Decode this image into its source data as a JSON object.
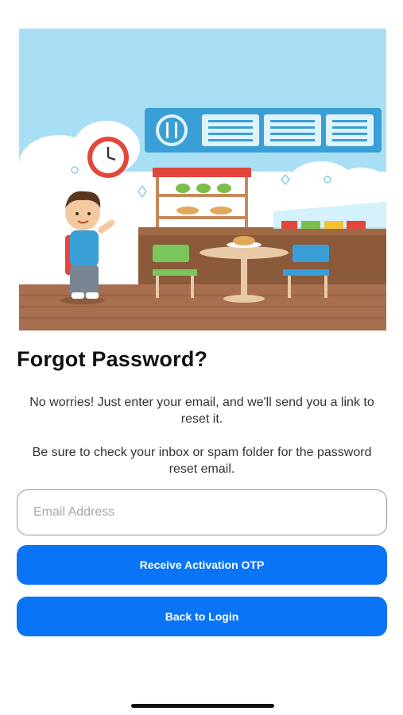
{
  "header": {
    "title": "Forgot Password?"
  },
  "main": {
    "description_1": "No worries! Just enter your email, and we'll send you a link to reset it.",
    "description_2": "Be sure to check your inbox or spam folder for the password reset email.",
    "email_input": {
      "placeholder": "Email Address",
      "value": ""
    },
    "otp_button_label": "Receive Activation OTP",
    "back_button_label": "Back to Login"
  },
  "illustration": {
    "name": "cafeteria-illustration",
    "icon": "fork-knife-icon"
  },
  "colors": {
    "primary": "#0a74f7",
    "text": "#111111",
    "sky": "#a6dcf3"
  }
}
